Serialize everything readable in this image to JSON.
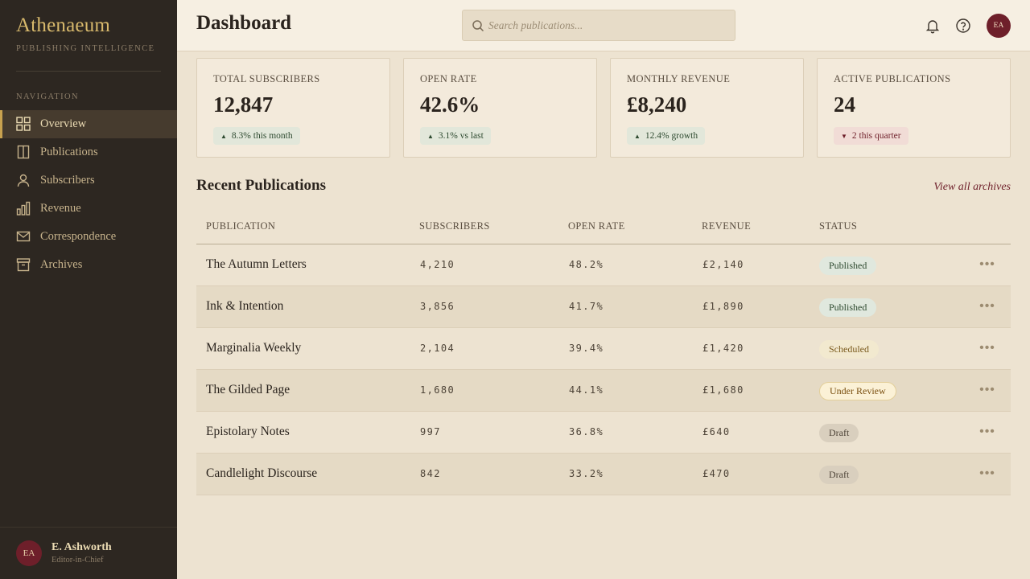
{
  "brand": {
    "title": "Athenaeum",
    "subtitle": "PUBLISHING INTELLIGENCE"
  },
  "nav": {
    "heading": "NAVIGATION",
    "items": [
      {
        "label": "Overview",
        "icon": "grid-icon",
        "active": true
      },
      {
        "label": "Publications",
        "icon": "book-icon"
      },
      {
        "label": "Subscribers",
        "icon": "person-icon"
      },
      {
        "label": "Revenue",
        "icon": "bar-chart-icon"
      },
      {
        "label": "Correspondence",
        "icon": "envelope-icon"
      },
      {
        "label": "Archives",
        "icon": "archive-box-icon"
      }
    ]
  },
  "user": {
    "initials": "EA",
    "name": "E. Ashworth",
    "role": "Editor-in-Chief"
  },
  "header": {
    "title": "Dashboard",
    "search_placeholder": "Search publications...",
    "avatar_initials": "EA"
  },
  "stats": [
    {
      "label": "TOTAL SUBSCRIBERS",
      "value": "12,847",
      "delta": "8.3% this month",
      "direction": "up"
    },
    {
      "label": "OPEN RATE",
      "value": "42.6%",
      "delta": "3.1% vs last",
      "direction": "up"
    },
    {
      "label": "MONTHLY REVENUE",
      "value": "£8,240",
      "delta": "12.4% growth",
      "direction": "up"
    },
    {
      "label": "ACTIVE PUBLICATIONS",
      "value": "24",
      "delta": "2 this quarter",
      "direction": "down"
    }
  ],
  "recent": {
    "title": "Recent Publications",
    "view_all": "View all archives",
    "columns": [
      "PUBLICATION",
      "SUBSCRIBERS",
      "OPEN RATE",
      "REVENUE",
      "STATUS"
    ],
    "rows": [
      {
        "name": "The Autumn Letters",
        "subscribers": "4,210",
        "open_rate": "48.2%",
        "revenue": "£2,140",
        "status": "Published"
      },
      {
        "name": "Ink & Intention",
        "subscribers": "3,856",
        "open_rate": "41.7%",
        "revenue": "£1,890",
        "status": "Published"
      },
      {
        "name": "Marginalia Weekly",
        "subscribers": "2,104",
        "open_rate": "39.4%",
        "revenue": "£1,420",
        "status": "Scheduled"
      },
      {
        "name": "The Gilded Page",
        "subscribers": "1,680",
        "open_rate": "44.1%",
        "revenue": "£1,680",
        "status": "Under Review"
      },
      {
        "name": "Epistolary Notes",
        "subscribers": "997",
        "open_rate": "36.8%",
        "revenue": "£640",
        "status": "Draft"
      },
      {
        "name": "Candlelight Discourse",
        "subscribers": "842",
        "open_rate": "33.2%",
        "revenue": "£470",
        "status": "Draft"
      }
    ]
  },
  "colors": {
    "sidebar_bg": "#2d2721",
    "accent_gold": "#d8b96c",
    "accent_burgundy": "#6e1f2a",
    "page_bg": "#ede3d1"
  }
}
